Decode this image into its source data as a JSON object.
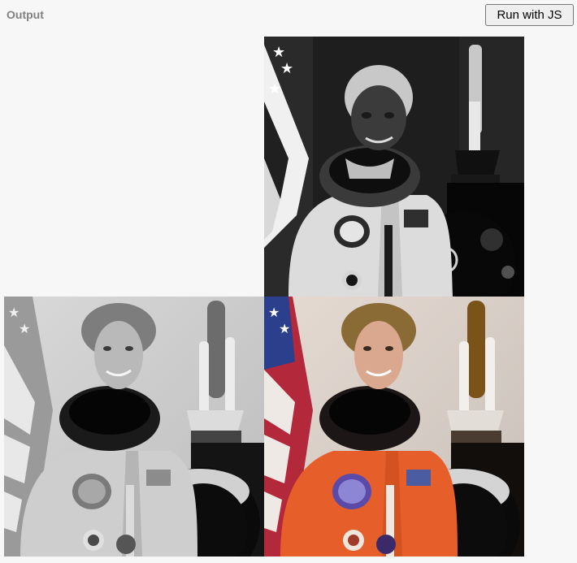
{
  "header": {
    "output_label": "Output",
    "run_button_label": "Run with JS"
  },
  "images": [
    {
      "name": "hsv-output-image",
      "subject": "astronaut portrait",
      "variant": "hsv-channels-as-rgb"
    },
    {
      "name": "grayscale-output-image",
      "subject": "astronaut portrait",
      "variant": "grayscale"
    },
    {
      "name": "original-rgb-image",
      "subject": "astronaut portrait",
      "variant": "original-color"
    }
  ],
  "colors": {
    "page_background": "#f7f7f7",
    "label_gray": "#808080",
    "button_background": "#efefef",
    "button_border": "#767676"
  }
}
